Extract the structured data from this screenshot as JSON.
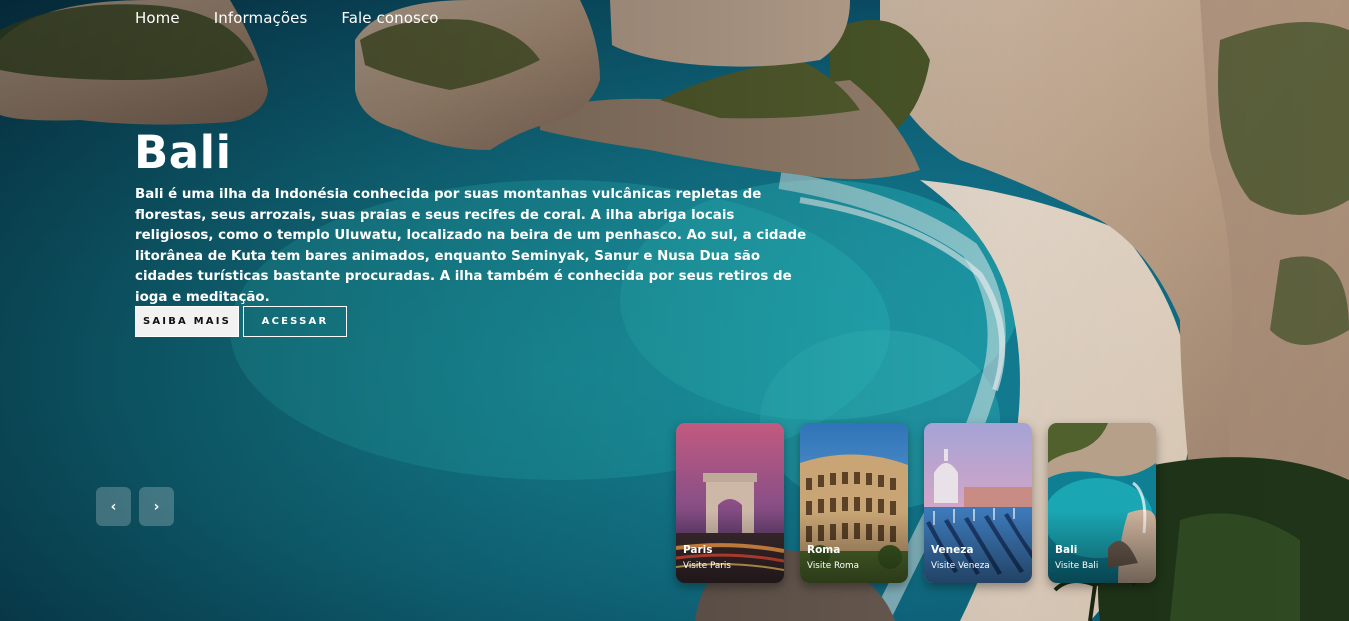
{
  "nav": {
    "items": [
      {
        "label": "Home"
      },
      {
        "label": "Informações"
      },
      {
        "label": "Fale conosco"
      }
    ]
  },
  "hero": {
    "title": "Bali",
    "description": "Bali é uma ilha da Indonésia conhecida por suas montanhas vulcânicas repletas de florestas, seus arrozais, suas praias e seus recifes de coral. A ilha abriga locais religiosos, como o templo Uluwatu, localizado na beira de um penhasco. Ao sul, a cidade litorânea de Kuta tem bares animados, enquanto Seminyak, Sanur e Nusa Dua são cidades turísticas bastante procuradas. A ilha também é conhecida por seus retiros de ioga e meditação.",
    "primary_button": "SAIBA MAIS",
    "secondary_button": "ACESSAR"
  },
  "slider": {
    "prev_icon": "chevron-left-icon",
    "next_icon": "chevron-right-icon",
    "prev_label": "‹",
    "next_label": "›"
  },
  "cards": [
    {
      "name": "Paris",
      "subtitle": "Visite Paris"
    },
    {
      "name": "Roma",
      "subtitle": "Visite Roma"
    },
    {
      "name": "Veneza",
      "subtitle": "Visite Veneza"
    },
    {
      "name": "Bali",
      "subtitle": "Visite Bali"
    }
  ],
  "colors": {
    "sea_deep": "#0a4a63",
    "sea_turquoise": "#1ba7b4",
    "cliff": "#c9b29c",
    "sand": "#e8dccd",
    "button_light": "#f2f2f2"
  }
}
